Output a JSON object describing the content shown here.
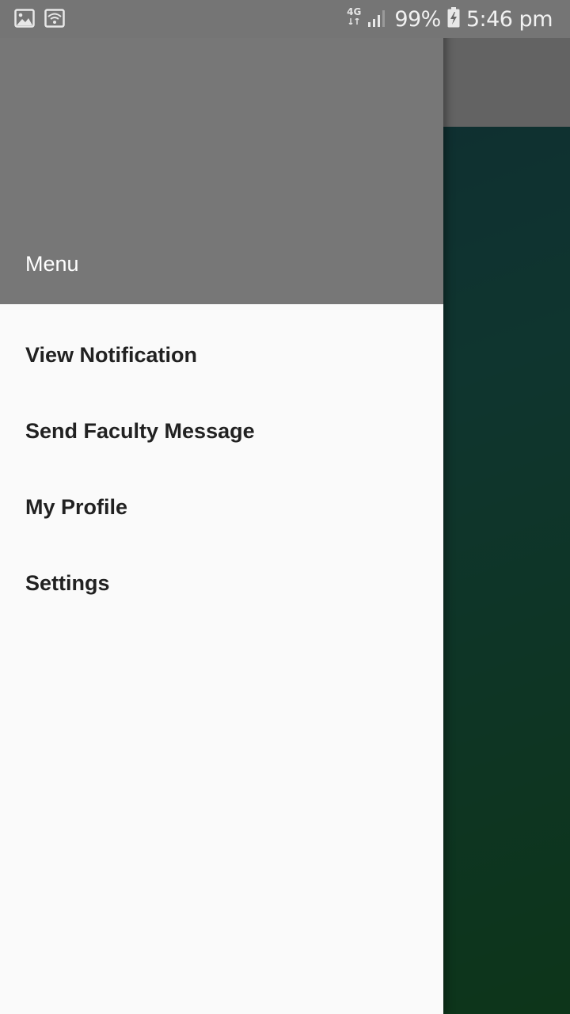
{
  "status_bar": {
    "network_type": "4G",
    "battery_percent": "99%",
    "time": "5:46 pm",
    "icons": [
      "gallery-icon",
      "wifi-icon",
      "network-4g-icon",
      "signal-icon",
      "battery-charging-icon"
    ]
  },
  "drawer": {
    "header_title": "Menu",
    "items": [
      {
        "label": "View Notification"
      },
      {
        "label": "Send Faculty Message"
      },
      {
        "label": "My Profile"
      },
      {
        "label": "Settings"
      }
    ]
  },
  "colors": {
    "status_bar": "#757575",
    "drawer_header": "#777777",
    "drawer_background": "#fafafa",
    "menu_text": "#212121",
    "background_gradient_start": "#1e5566",
    "background_gradient_end": "#1a6a34"
  }
}
